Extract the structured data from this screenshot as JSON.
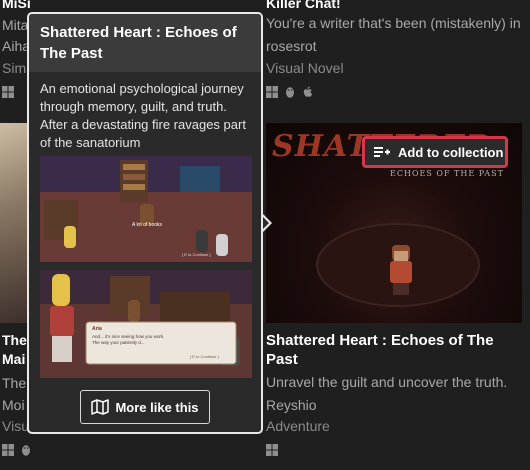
{
  "left_card_top": {
    "title": "MiSide DEMO",
    "author": "Mita",
    "line2": "Aiha",
    "genre": "Simu"
  },
  "left_card_bottom": {
    "title_line1": "The",
    "title_line2": "Mai",
    "tagline": "The",
    "author": "Moi",
    "genre": "Visu"
  },
  "right_card_top": {
    "title": "Killer Chat!",
    "tagline": "You're a writer that's been (mistakenly) in",
    "author": "rosesrot",
    "genre": "Visual Novel"
  },
  "right_card": {
    "thumb_logo": "SHATTERED",
    "thumb_subtitle": "ECHOES OF THE PAST",
    "add_button_label": "Add to collection",
    "title": "Shattered Heart : Echoes of The Past",
    "tagline": "Unravel the guilt and uncover the truth.",
    "author": "Reyshio",
    "genre": "Adventure"
  },
  "popup": {
    "title": "Shattered Heart : Echoes of The Past",
    "description": "An emotional psychological journey through memory, guilt, and truth. After a devastating fire ravages part of the sanatorium",
    "screenshot1_caption": "A lot of books",
    "screenshot1_hint": "[ E to Continue ]",
    "screenshot2_speaker": "Aria",
    "screenshot2_text": "And... it's nice seeing how you work. The way your patiently d...",
    "screenshot2_hint": "[ E to Continue ]",
    "more_button_label": "More like this"
  },
  "icons": [
    "windows-icon",
    "linux-icon",
    "apple-icon",
    "add-to-list-icon",
    "map-icon"
  ]
}
